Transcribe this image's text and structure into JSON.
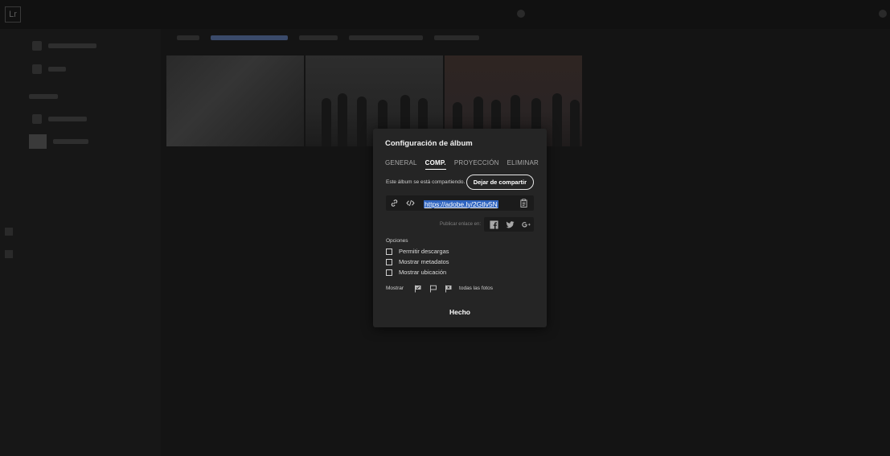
{
  "modal": {
    "title": "Configuración de álbum",
    "tabs": [
      {
        "label": "GENERAL",
        "active": false
      },
      {
        "label": "COMP.",
        "active": true
      },
      {
        "label": "PROYECCIÓN",
        "active": false
      },
      {
        "label": "ELIMINAR",
        "active": false
      }
    ],
    "share_status": "Este álbum se está compartiendo.",
    "unshare_button": "Dejar de compartir",
    "share_url": "https://adobe.ly/2Gtlv5N",
    "publish_label": "Publicar enlace en:",
    "social": [
      "facebook-icon",
      "twitter-icon",
      "google-plus-icon"
    ],
    "options_title": "Opciones",
    "options": [
      {
        "label": "Permitir descargas",
        "checked": false
      },
      {
        "label": "Mostrar metadatos",
        "checked": false
      },
      {
        "label": "Mostrar ubicación",
        "checked": false
      }
    ],
    "show_label": "Mostrar",
    "show_value": "todas las fotos",
    "done_button": "Hecho"
  },
  "colors": {
    "modal_bg": "#252525",
    "url_highlight": "#2f64c0",
    "app_bg": "#141414"
  }
}
